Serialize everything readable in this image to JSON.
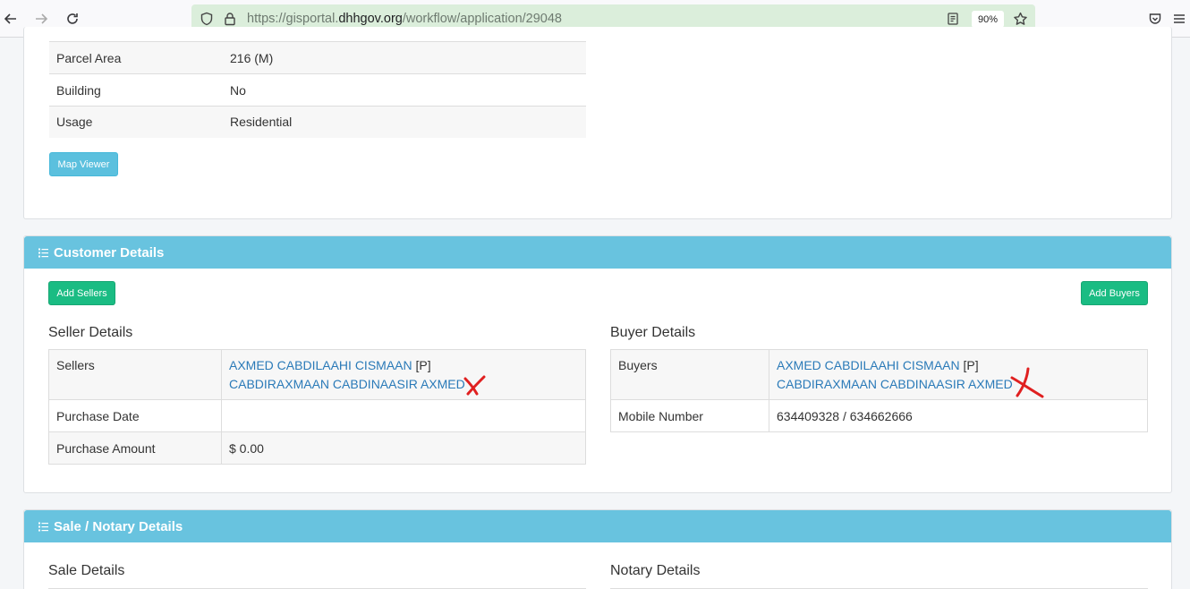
{
  "browser": {
    "url_prefix": "https://gisportal.",
    "url_host": "dhhgov.org",
    "url_path": "/workflow/application/29048",
    "zoom": "90%"
  },
  "property": {
    "rows": [
      {
        "label": "Parcel Area",
        "value": "216 (M)"
      },
      {
        "label": "Building",
        "value": "No"
      },
      {
        "label": "Usage",
        "value": "Residential"
      }
    ],
    "map_button": "Map Viewer"
  },
  "customer": {
    "title": "Customer Details",
    "add_sellers": "Add Sellers",
    "add_buyers": "Add Buyers",
    "seller": {
      "title": "Seller Details",
      "sellers_label": "Sellers",
      "seller1_name": "AXMED CABDILAAHI CISMAAN",
      "seller1_tag": "[P]",
      "seller2_name": "CABDIRAXMAAN CABDINAASIR AXMED",
      "purchase_date_label": "Purchase Date",
      "purchase_date": "",
      "purchase_amount_label": "Purchase Amount",
      "purchase_amount": "$ 0.00"
    },
    "buyer": {
      "title": "Buyer Details",
      "buyers_label": "Buyers",
      "buyer1_name": "AXMED CABDILAAHI CISMAAN",
      "buyer1_tag": "[P]",
      "buyer2_name": "CABDIRAXMAAN CABDINAASIR AXMED",
      "mobile_label": "Mobile Number",
      "mobile": "634409328 / 634662666"
    }
  },
  "sale": {
    "title": "Sale / Notary Details",
    "sale_details": "Sale Details",
    "notary_details": "Notary Details"
  },
  "colors": {
    "panel_header": "#68c3df",
    "green_button": "#1abc83",
    "link": "#2a7ab8",
    "annotation_mark": "#e02020"
  }
}
